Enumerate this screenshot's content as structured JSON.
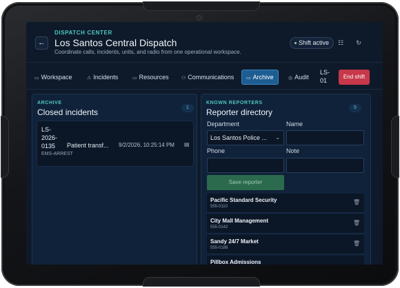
{
  "header": {
    "eyebrow": "DISPATCH CENTER",
    "title": "Los Santos Central Dispatch",
    "subtitle": "Coordinate calls, incidents, units, and radio from one operational workspace.",
    "shift_status": "Shift active",
    "back_icon": "←",
    "settings_icon": "☷",
    "refresh_icon": "↻"
  },
  "nav": {
    "tabs": [
      {
        "label": "Workspace",
        "icon": "▭"
      },
      {
        "label": "Incidents",
        "icon": "⚠"
      },
      {
        "label": "Resources",
        "icon": "▭"
      },
      {
        "label": "Communications",
        "icon": "⚇"
      },
      {
        "label": "Archive",
        "icon": "▭"
      },
      {
        "label": "Audit",
        "icon": "◎"
      }
    ],
    "unit_label_line1": "LS-",
    "unit_label_line2": "01",
    "end_shift": "End shift"
  },
  "archive": {
    "eyebrow": "ARCHIVE",
    "title": "Closed incidents",
    "count": "1",
    "incidents": [
      {
        "id": "LS-2026-0135",
        "type": "EMS-ARREST",
        "description": "Patient transf...",
        "time": "9/2/2026, 10:25:14 PM",
        "icon": "file-icon"
      }
    ]
  },
  "reporters": {
    "eyebrow": "KNOWN REPORTERS",
    "title": "Reporter directory",
    "count": "5",
    "department_label": "Department",
    "department_value": "Los Santos Police ...",
    "name_label": "Name",
    "name_value": "",
    "phone_label": "Phone",
    "phone_value": "",
    "note_label": "Note",
    "note_value": "",
    "save_label": "Save reporter",
    "list": [
      {
        "name": "Pacific Standard Security",
        "phone": "555-0110"
      },
      {
        "name": "City Mall Management",
        "phone": "555-0142"
      },
      {
        "name": "Sandy 24/7 Market",
        "phone": "555-0188"
      },
      {
        "name": "Pillbox Admissions",
        "phone": ""
      }
    ]
  },
  "colors": {
    "accent": "#4ec7c0",
    "active_tab": "#1d5d92",
    "end_shift": "#c7384a",
    "save": "#2b6a4d",
    "background": "#0e1a2a"
  }
}
